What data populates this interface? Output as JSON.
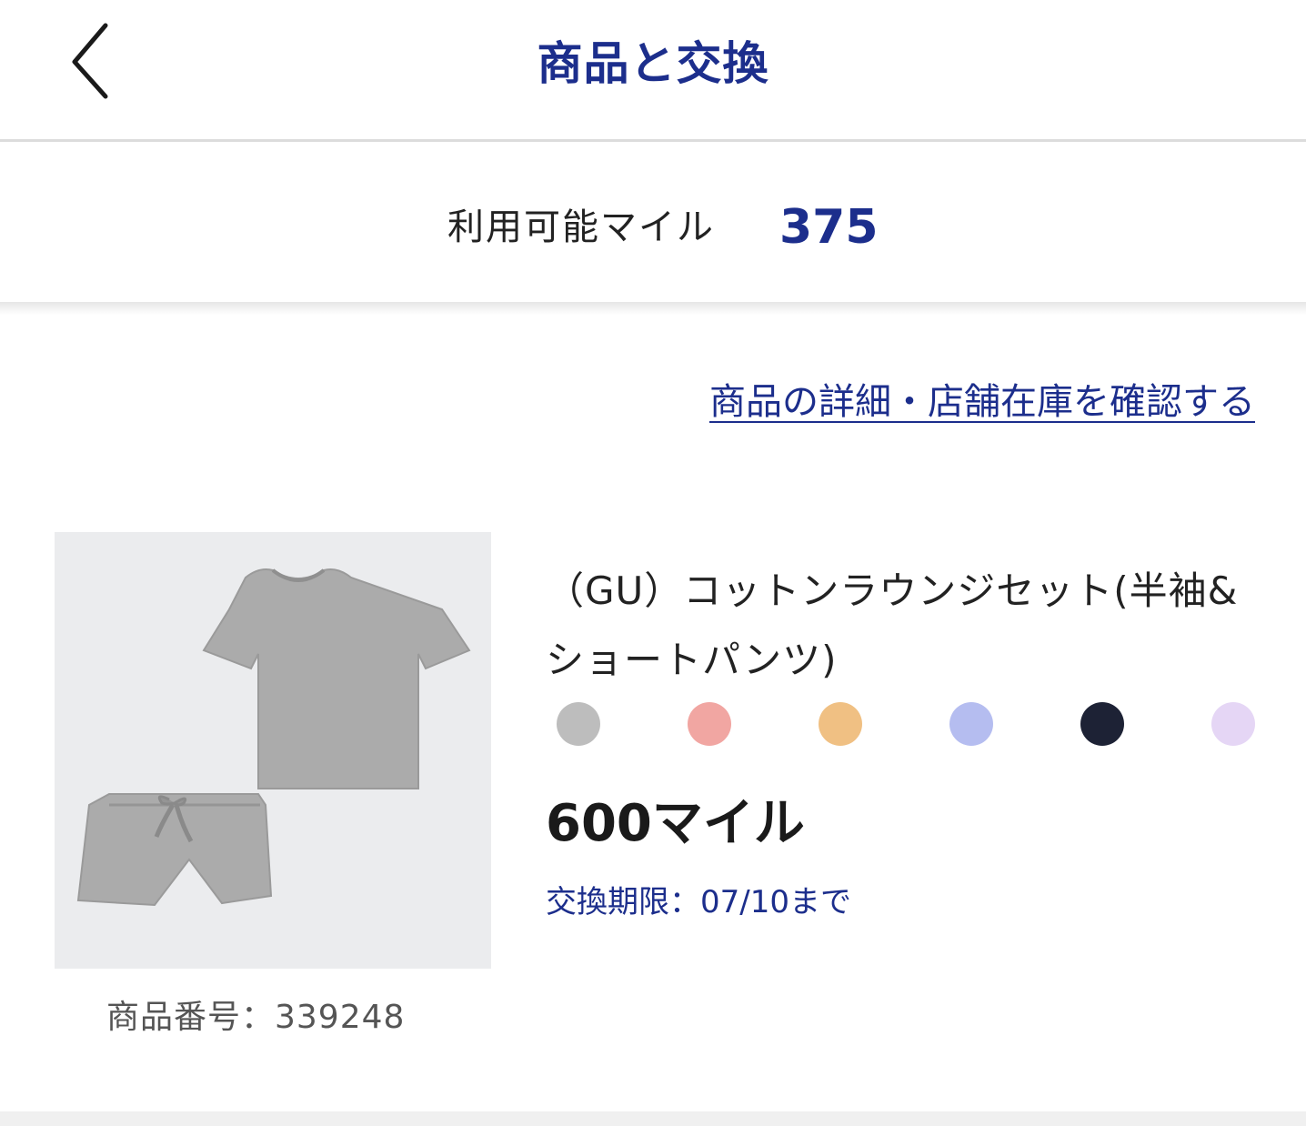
{
  "header": {
    "title": "商品と交換",
    "back_icon": "chevron-left-icon"
  },
  "miles": {
    "label": "利用可能マイル",
    "value": "375"
  },
  "detail_link": {
    "label": "商品の詳細・店舗在庫を確認する"
  },
  "product": {
    "name": "（GU）コットンラウンジセット(半袖&ショートパンツ)",
    "number_label": "商品番号：339248",
    "price": "600マイル",
    "deadline": "交換期限：07/10まで",
    "colors": [
      {
        "name": "gray",
        "hex": "#bdbdbd"
      },
      {
        "name": "pink",
        "hex": "#f1a6a2"
      },
      {
        "name": "orange",
        "hex": "#f0c083"
      },
      {
        "name": "blue",
        "hex": "#b5bdf0"
      },
      {
        "name": "navy",
        "hex": "#1d2235"
      },
      {
        "name": "purple",
        "hex": "#e5d6f5"
      }
    ]
  },
  "theme": {
    "accent": "#1c2e8c",
    "text": "#222222"
  }
}
